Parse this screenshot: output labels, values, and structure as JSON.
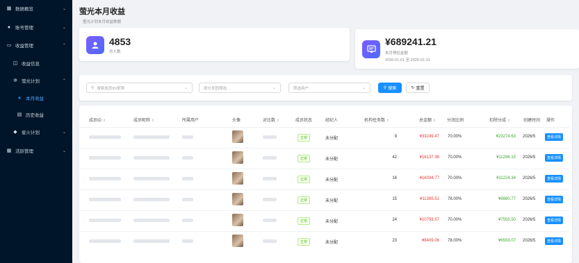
{
  "sidebar": {
    "items": [
      {
        "label": "数据概览",
        "icon": "grid-icon",
        "chev": "⌄"
      },
      {
        "label": "账号管理",
        "icon": "user-icon",
        "chev": "⌄"
      },
      {
        "label": "收益管理",
        "icon": "folder-icon",
        "chev": "⌃"
      },
      {
        "label": "收益信息",
        "icon": "money-icon",
        "chev": ""
      },
      {
        "label": "萤光计划",
        "icon": "sparkle-icon",
        "chev": "⌃"
      },
      {
        "label": "本月收益",
        "icon": "person-icon",
        "chev": ""
      },
      {
        "label": "历史收益",
        "icon": "document-icon",
        "chev": ""
      },
      {
        "label": "星火计划",
        "icon": "diamond-icon",
        "chev": "⌄"
      },
      {
        "label": "活跃管理",
        "icon": "table-icon",
        "chev": "⌄"
      }
    ]
  },
  "header": {
    "title": "萤光本月收益",
    "subtitle": "萤光计划本月收益数据"
  },
  "stats": {
    "card1": {
      "value": "4853",
      "label": "总人数"
    },
    "card2": {
      "value": "¥689241.21",
      "label": "本月预估金额",
      "range": "2026-01-01 至 2026-01-31"
    }
  },
  "filter": {
    "search_placeholder": "搜索成员ID/昵称",
    "group_placeholder": "按分发团筛选",
    "user_placeholder": "筛选用户",
    "search_btn": "搜索",
    "reset_btn": "重置"
  },
  "table": {
    "headers": [
      "成员ID",
      "成员昵称",
      "所属用户",
      "头像",
      "对比数",
      "成员状态",
      "经纪人",
      "机构任务数",
      "总金额",
      "分润比例",
      "扣除分成",
      "创建时间",
      "操作"
    ],
    "rows": [
      {
        "status": "正常",
        "agent": "未分配",
        "tasks": "9",
        "total": "¥33249.47",
        "ratio": "70.00%",
        "deduct": "¥23274.63",
        "date": "2026/5",
        "op": "查看详情"
      },
      {
        "status": "正常",
        "agent": "未分配",
        "tasks": "42",
        "total": "¥16137.36",
        "ratio": "70.00%",
        "deduct": "¥11296.15",
        "date": "2026/5",
        "op": "查看详情"
      },
      {
        "status": "正常",
        "agent": "未分配",
        "tasks": "16",
        "total": "¥16034.77",
        "ratio": "70.00%",
        "deduct": "¥11224.34",
        "date": "2026/5",
        "op": "查看详情"
      },
      {
        "status": "正常",
        "agent": "未分配",
        "tasks": "15",
        "total": "¥11385.51",
        "ratio": "78.00%",
        "deduct": "¥8880.77",
        "date": "2026/5",
        "op": "查看详情"
      },
      {
        "status": "正常",
        "agent": "未分配",
        "tasks": "24",
        "total": "¥10793.57",
        "ratio": "70.00%",
        "deduct": "¥7555.50",
        "date": "2026/5",
        "op": "查看详情"
      },
      {
        "status": "正常",
        "agent": "未分配",
        "tasks": "23",
        "total": "¥8409.06",
        "ratio": "78.00%",
        "deduct": "¥6559.07",
        "date": "2026/5",
        "op": "查看详情"
      }
    ]
  }
}
